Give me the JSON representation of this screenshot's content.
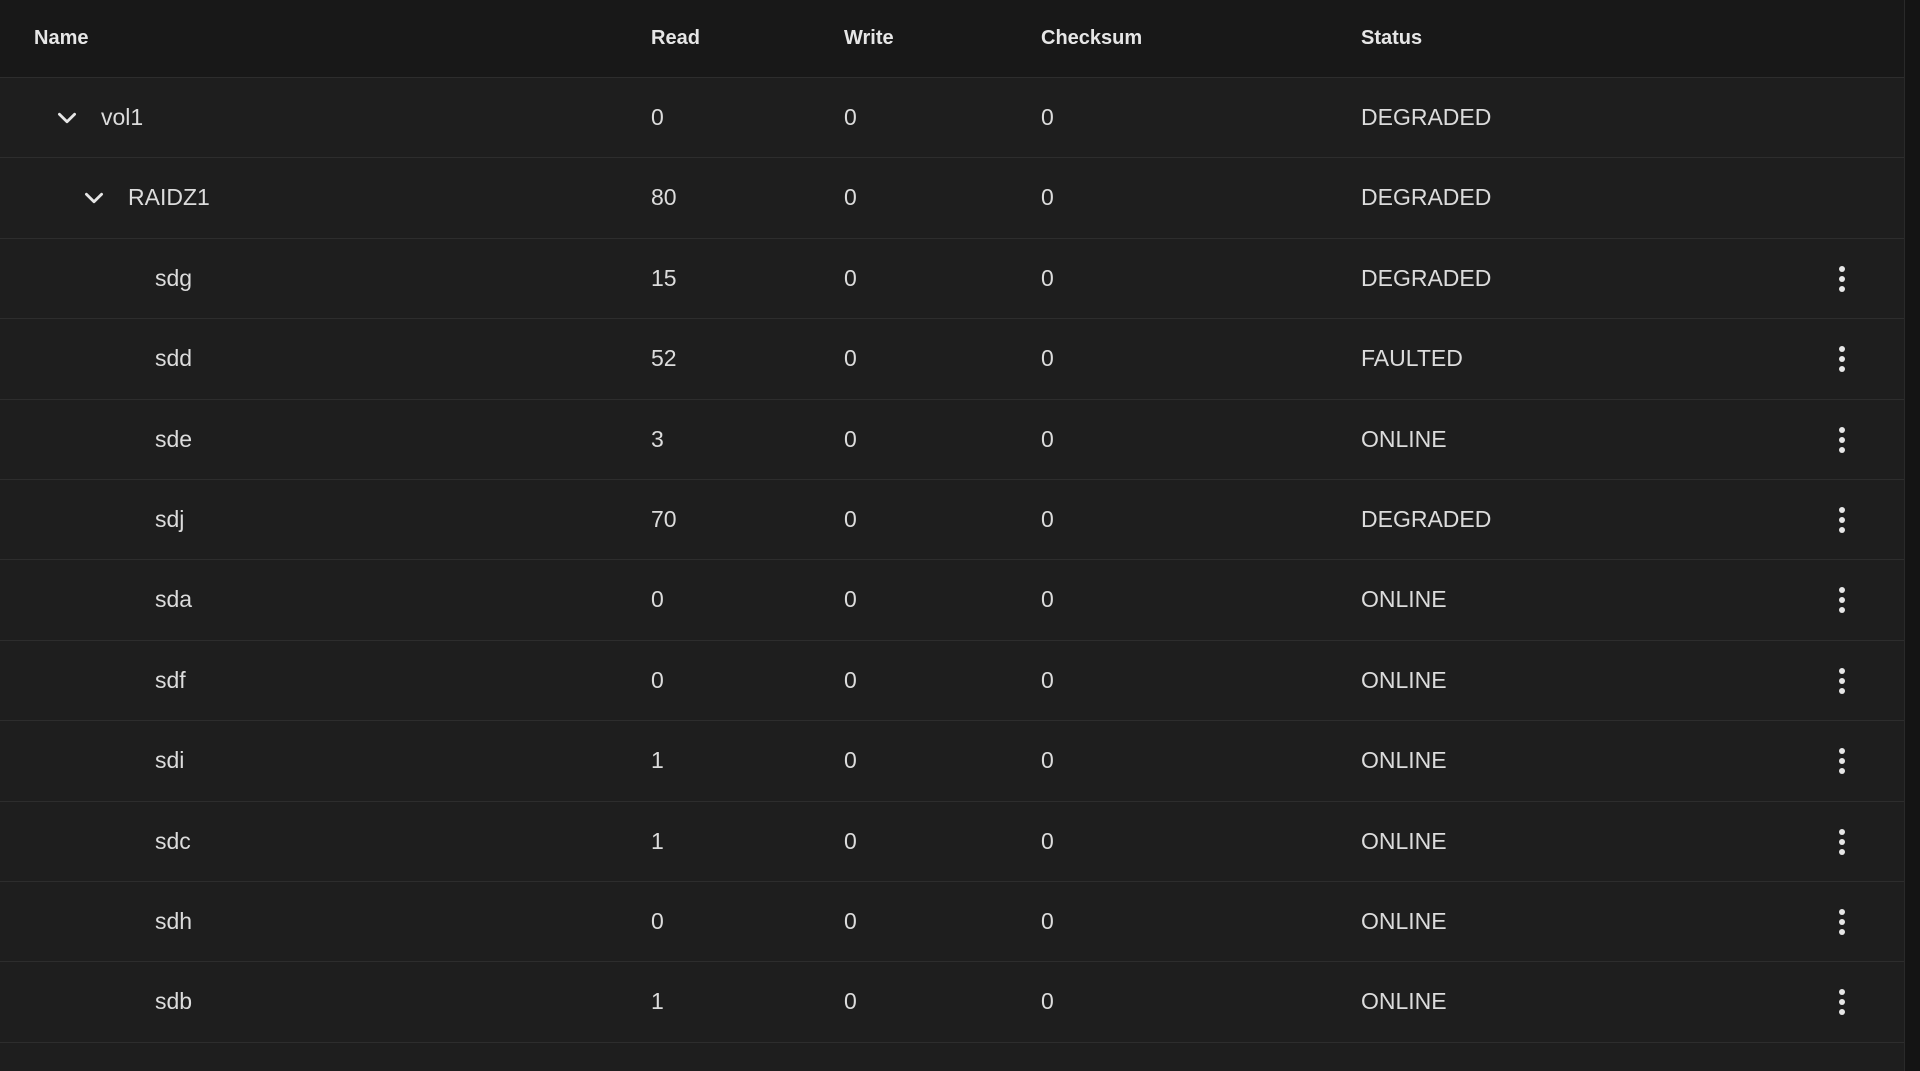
{
  "columns": {
    "name": "Name",
    "read": "Read",
    "write": "Write",
    "checksum": "Checksum",
    "status": "Status"
  },
  "rows": [
    {
      "name": "vol1",
      "read": "0",
      "write": "0",
      "checksum": "0",
      "status": "DEGRADED"
    },
    {
      "name": "RAIDZ1",
      "read": "80",
      "write": "0",
      "checksum": "0",
      "status": "DEGRADED"
    },
    {
      "name": "sdg",
      "read": "15",
      "write": "0",
      "checksum": "0",
      "status": "DEGRADED"
    },
    {
      "name": "sdd",
      "read": "52",
      "write": "0",
      "checksum": "0",
      "status": "FAULTED"
    },
    {
      "name": "sde",
      "read": "3",
      "write": "0",
      "checksum": "0",
      "status": "ONLINE"
    },
    {
      "name": "sdj",
      "read": "70",
      "write": "0",
      "checksum": "0",
      "status": "DEGRADED"
    },
    {
      "name": "sda",
      "read": "0",
      "write": "0",
      "checksum": "0",
      "status": "ONLINE"
    },
    {
      "name": "sdf",
      "read": "0",
      "write": "0",
      "checksum": "0",
      "status": "ONLINE"
    },
    {
      "name": "sdi",
      "read": "1",
      "write": "0",
      "checksum": "0",
      "status": "ONLINE"
    },
    {
      "name": "sdc",
      "read": "1",
      "write": "0",
      "checksum": "0",
      "status": "ONLINE"
    },
    {
      "name": "sdh",
      "read": "0",
      "write": "0",
      "checksum": "0",
      "status": "ONLINE"
    },
    {
      "name": "sdb",
      "read": "1",
      "write": "0",
      "checksum": "0",
      "status": "ONLINE"
    }
  ],
  "icons": {
    "expand": "chevron-down-icon",
    "actions": "more-vert-icon"
  },
  "colors": {
    "background": "#1e1e1e",
    "header_background": "#181818",
    "text": "#dcdcdc",
    "divider": "#2d2d2d"
  }
}
